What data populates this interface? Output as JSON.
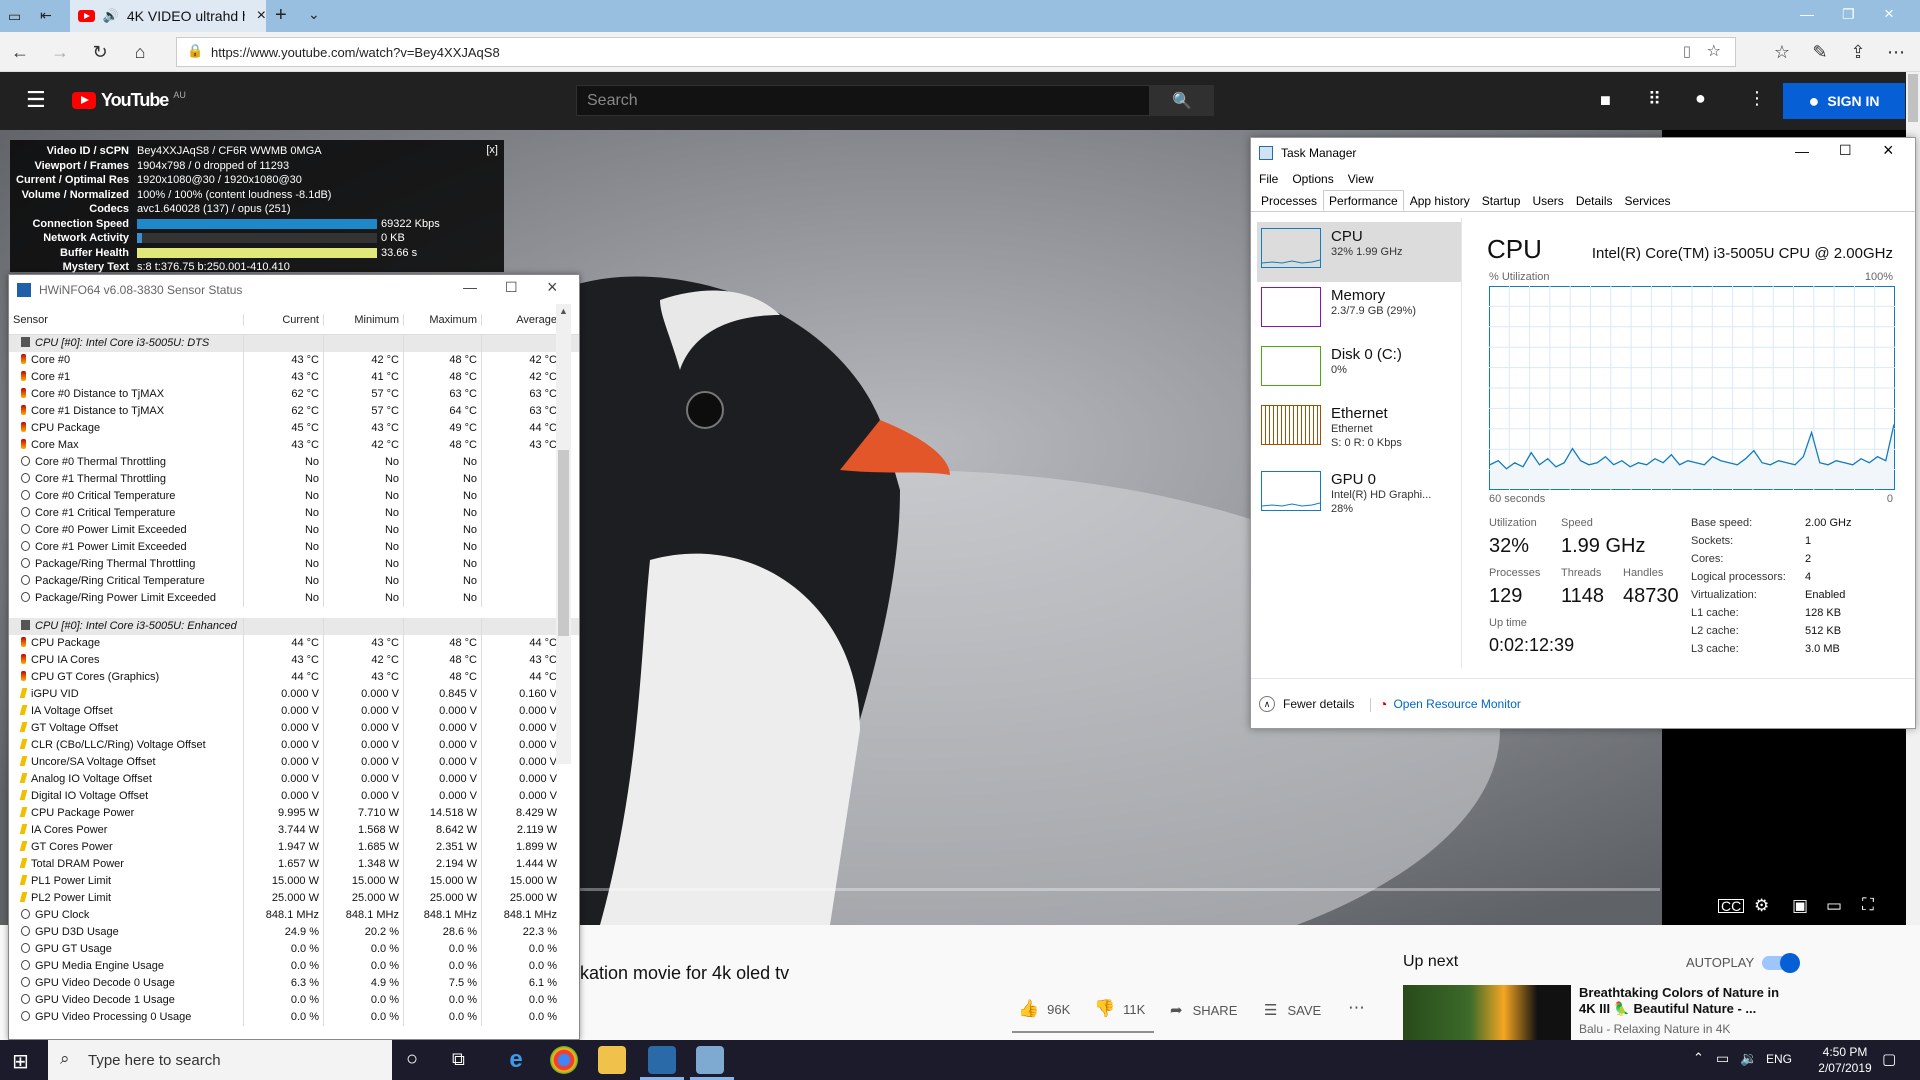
{
  "browser": {
    "tab_title": "4K VIDEO ultrahd h",
    "url": "https://www.youtube.com/watch?v=Bey4XXJAqS8"
  },
  "youtube": {
    "logo": "YouTube",
    "region": "AU",
    "search_placeholder": "Search",
    "sign_in": "SIGN IN",
    "video_title_partial": "kation movie for 4k oled tv",
    "likes": "96K",
    "dislikes": "11K",
    "share": "SHARE",
    "save": "SAVE",
    "up_next": "Up next",
    "autoplay": "AUTOPLAY",
    "next_title": "Breathtaking Colors of Nature in 4K III 🦜 Beautiful Nature - ...",
    "next_channel": "Balu - Relaxing Nature in 4K"
  },
  "stats": {
    "close": "[x]",
    "rows": [
      {
        "label": "Video ID / sCPN",
        "value": "Bey4XXJAqS8 / CF6R WWMB 0MGA"
      },
      {
        "label": "Viewport / Frames",
        "value": "1904x798 / 0 dropped of 11293"
      },
      {
        "label": "Current / Optimal Res",
        "value": "1920x1080@30 / 1920x1080@30"
      },
      {
        "label": "Volume / Normalized",
        "value": "100% / 100% (content loudness -8.1dB)"
      },
      {
        "label": "Codecs",
        "value": "avc1.640028 (137) / opus (251)"
      },
      {
        "label": "Connection Speed",
        "value": "69322 Kbps"
      },
      {
        "label": "Network Activity",
        "value": "0 KB"
      },
      {
        "label": "Buffer Health",
        "value": "33.66 s"
      },
      {
        "label": "Mystery Text",
        "value": "s:8 t:376.75 b:250.001-410.410"
      }
    ]
  },
  "hwinfo": {
    "title": "HWiNFO64 v6.08-3830 Sensor Status",
    "columns": [
      "Sensor",
      "Current",
      "Minimum",
      "Maximum",
      "Average"
    ],
    "rows": [
      {
        "k": "g",
        "n": "CPU [#0]: Intel Core i3-5005U: DTS"
      },
      {
        "k": "t",
        "n": "Core #0",
        "c": "43 °C",
        "mi": "42 °C",
        "ma": "48 °C",
        "a": "42 °C"
      },
      {
        "k": "t",
        "n": "Core #1",
        "c": "43 °C",
        "mi": "41 °C",
        "ma": "48 °C",
        "a": "42 °C"
      },
      {
        "k": "t",
        "n": "Core #0 Distance to TjMAX",
        "c": "62 °C",
        "mi": "57 °C",
        "ma": "63 °C",
        "a": "63 °C"
      },
      {
        "k": "t",
        "n": "Core #1 Distance to TjMAX",
        "c": "62 °C",
        "mi": "57 °C",
        "ma": "64 °C",
        "a": "63 °C"
      },
      {
        "k": "t",
        "n": "CPU Package",
        "c": "45 °C",
        "mi": "43 °C",
        "ma": "49 °C",
        "a": "44 °C"
      },
      {
        "k": "t",
        "n": "Core Max",
        "c": "43 °C",
        "mi": "42 °C",
        "ma": "48 °C",
        "a": "43 °C"
      },
      {
        "k": "n",
        "n": "Core #0 Thermal Throttling",
        "c": "No",
        "mi": "No",
        "ma": "No",
        "a": ""
      },
      {
        "k": "n",
        "n": "Core #1 Thermal Throttling",
        "c": "No",
        "mi": "No",
        "ma": "No",
        "a": ""
      },
      {
        "k": "n",
        "n": "Core #0 Critical Temperature",
        "c": "No",
        "mi": "No",
        "ma": "No",
        "a": ""
      },
      {
        "k": "n",
        "n": "Core #1 Critical Temperature",
        "c": "No",
        "mi": "No",
        "ma": "No",
        "a": ""
      },
      {
        "k": "n",
        "n": "Core #0 Power Limit Exceeded",
        "c": "No",
        "mi": "No",
        "ma": "No",
        "a": ""
      },
      {
        "k": "n",
        "n": "Core #1 Power Limit Exceeded",
        "c": "No",
        "mi": "No",
        "ma": "No",
        "a": ""
      },
      {
        "k": "n",
        "n": "Package/Ring Thermal Throttling",
        "c": "No",
        "mi": "No",
        "ma": "No",
        "a": ""
      },
      {
        "k": "n",
        "n": "Package/Ring Critical Temperature",
        "c": "No",
        "mi": "No",
        "ma": "No",
        "a": ""
      },
      {
        "k": "n",
        "n": "Package/Ring Power Limit Exceeded",
        "c": "No",
        "mi": "No",
        "ma": "No",
        "a": ""
      },
      {
        "k": "e",
        "n": ""
      },
      {
        "k": "g",
        "n": "CPU [#0]: Intel Core i3-5005U: Enhanced"
      },
      {
        "k": "t",
        "n": "CPU Package",
        "c": "44 °C",
        "mi": "43 °C",
        "ma": "48 °C",
        "a": "44 °C"
      },
      {
        "k": "t",
        "n": "CPU IA Cores",
        "c": "43 °C",
        "mi": "42 °C",
        "ma": "48 °C",
        "a": "43 °C"
      },
      {
        "k": "t",
        "n": "CPU GT Cores (Graphics)",
        "c": "44 °C",
        "mi": "43 °C",
        "ma": "48 °C",
        "a": "44 °C"
      },
      {
        "k": "v",
        "n": "iGPU VID",
        "c": "0.000 V",
        "mi": "0.000 V",
        "ma": "0.845 V",
        "a": "0.160 V"
      },
      {
        "k": "v",
        "n": "IA Voltage Offset",
        "c": "0.000 V",
        "mi": "0.000 V",
        "ma": "0.000 V",
        "a": "0.000 V"
      },
      {
        "k": "v",
        "n": "GT Voltage Offset",
        "c": "0.000 V",
        "mi": "0.000 V",
        "ma": "0.000 V",
        "a": "0.000 V"
      },
      {
        "k": "v",
        "n": "CLR (CBo/LLC/Ring) Voltage Offset",
        "c": "0.000 V",
        "mi": "0.000 V",
        "ma": "0.000 V",
        "a": "0.000 V"
      },
      {
        "k": "v",
        "n": "Uncore/SA Voltage Offset",
        "c": "0.000 V",
        "mi": "0.000 V",
        "ma": "0.000 V",
        "a": "0.000 V"
      },
      {
        "k": "v",
        "n": "Analog IO Voltage Offset",
        "c": "0.000 V",
        "mi": "0.000 V",
        "ma": "0.000 V",
        "a": "0.000 V"
      },
      {
        "k": "v",
        "n": "Digital IO Voltage Offset",
        "c": "0.000 V",
        "mi": "0.000 V",
        "ma": "0.000 V",
        "a": "0.000 V"
      },
      {
        "k": "v",
        "n": "CPU Package Power",
        "c": "9.995 W",
        "mi": "7.710 W",
        "ma": "14.518 W",
        "a": "8.429 W"
      },
      {
        "k": "v",
        "n": "IA Cores Power",
        "c": "3.744 W",
        "mi": "1.568 W",
        "ma": "8.642 W",
        "a": "2.119 W"
      },
      {
        "k": "v",
        "n": "GT Cores Power",
        "c": "1.947 W",
        "mi": "1.685 W",
        "ma": "2.351 W",
        "a": "1.899 W"
      },
      {
        "k": "v",
        "n": "Total DRAM Power",
        "c": "1.657 W",
        "mi": "1.348 W",
        "ma": "2.194 W",
        "a": "1.444 W"
      },
      {
        "k": "v",
        "n": "PL1 Power Limit",
        "c": "15.000 W",
        "mi": "15.000 W",
        "ma": "15.000 W",
        "a": "15.000 W"
      },
      {
        "k": "v",
        "n": "PL2 Power Limit",
        "c": "25.000 W",
        "mi": "25.000 W",
        "ma": "25.000 W",
        "a": "25.000 W"
      },
      {
        "k": "n",
        "n": "GPU Clock",
        "c": "848.1 MHz",
        "mi": "848.1 MHz",
        "ma": "848.1 MHz",
        "a": "848.1 MHz"
      },
      {
        "k": "n",
        "n": "GPU D3D Usage",
        "c": "24.9 %",
        "mi": "20.2 %",
        "ma": "28.6 %",
        "a": "22.3 %"
      },
      {
        "k": "n",
        "n": "GPU GT Usage",
        "c": "0.0 %",
        "mi": "0.0 %",
        "ma": "0.0 %",
        "a": "0.0 %"
      },
      {
        "k": "n",
        "n": "GPU Media Engine Usage",
        "c": "0.0 %",
        "mi": "0.0 %",
        "ma": "0.0 %",
        "a": "0.0 %"
      },
      {
        "k": "n",
        "n": "GPU Video Decode 0 Usage",
        "c": "6.3 %",
        "mi": "4.9 %",
        "ma": "7.5 %",
        "a": "6.1 %"
      },
      {
        "k": "n",
        "n": "GPU Video Decode 1 Usage",
        "c": "0.0 %",
        "mi": "0.0 %",
        "ma": "0.0 %",
        "a": "0.0 %"
      },
      {
        "k": "n",
        "n": "GPU Video Processing 0 Usage",
        "c": "0.0 %",
        "mi": "0.0 %",
        "ma": "0.0 %",
        "a": "0.0 %"
      }
    ]
  },
  "taskmgr": {
    "title": "Task Manager",
    "menu": [
      "File",
      "Options",
      "View"
    ],
    "tabs": [
      "Processes",
      "Performance",
      "App history",
      "Startup",
      "Users",
      "Details",
      "Services"
    ],
    "side": [
      {
        "name": "CPU",
        "sub1": "32% 1.99 GHz",
        "sub2": "",
        "sub3": "",
        "color": "#117dbb"
      },
      {
        "name": "Memory",
        "sub1": "2.3/7.9 GB (29%)",
        "sub2": "",
        "sub3": "",
        "color": "#8b12ae"
      },
      {
        "name": "Disk 0 (C:)",
        "sub1": "0%",
        "sub2": "",
        "sub3": "",
        "color": "#4da60c"
      },
      {
        "name": "Ethernet",
        "sub1": "Ethernet",
        "sub2": "S: 0 R: 0 Kbps",
        "sub3": "",
        "color": "#a74f01"
      },
      {
        "name": "GPU 0",
        "sub1": "Intel(R) HD Graphi...",
        "sub2": "28%",
        "sub3": "",
        "color": "#117dbb"
      }
    ],
    "heading": "CPU",
    "model": "Intel(R) Core(TM) i3-5005U CPU @ 2.00GHz",
    "util_label": "% Utilization",
    "util_max": "100%",
    "time_label": "60 seconds",
    "time_end": "0",
    "stats": {
      "utilization_l": "Utilization",
      "utilization": "32%",
      "speed_l": "Speed",
      "speed": "1.99 GHz",
      "processes_l": "Processes",
      "processes": "129",
      "threads_l": "Threads",
      "threads": "1148",
      "handles_l": "Handles",
      "handles": "48730",
      "uptime_l": "Up time",
      "uptime": "0:02:12:39"
    },
    "specs": [
      {
        "k": "Base speed:",
        "v": "2.00 GHz"
      },
      {
        "k": "Sockets:",
        "v": "1"
      },
      {
        "k": "Cores:",
        "v": "2"
      },
      {
        "k": "Logical processors:",
        "v": "4"
      },
      {
        "k": "Virtualization:",
        "v": "Enabled"
      },
      {
        "k": "L1 cache:",
        "v": "128 KB"
      },
      {
        "k": "L2 cache:",
        "v": "512 KB"
      },
      {
        "k": "L3 cache:",
        "v": "3.0 MB"
      }
    ],
    "fewer": "Fewer details",
    "resmon": "Open Resource Monitor"
  },
  "taskbar": {
    "search": "Type here to search",
    "lang": "ENG",
    "time": "4:50 PM",
    "date": "2/07/2019"
  }
}
